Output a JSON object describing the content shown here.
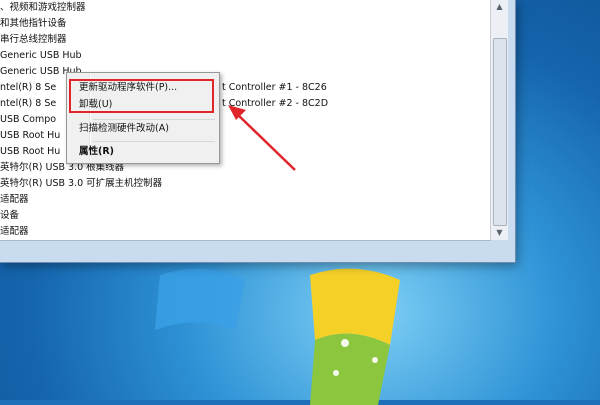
{
  "tree": {
    "rows": [
      "、视频和游戏控制器",
      "和其他指针设备",
      "串行总线控制器",
      "Generic USB Hub",
      "Generic USB Hub",
      "ntel(R) 8 Se",
      "ntel(R) 8 Se",
      "USB Compo",
      "USB Root Hu",
      "USB Root Hu",
      "英特尔(R) USB 3.0 根集线器",
      "英特尔(R) USB 3.0 可扩展主机控制器",
      "适配器",
      "设备",
      "适配器"
    ],
    "row_tail_1": "t Controller #1 - 8C26",
    "row_tail_2": "t Controller #2 - 8C2D"
  },
  "context_menu": {
    "update_driver": "更新驱动程序软件(P)...",
    "uninstall": "卸载(U)",
    "scan_hardware": "扫描检测硬件改动(A)",
    "properties": "属性(R)"
  },
  "colors": {
    "highlight": "#e0252b",
    "arrow": "#e0252b"
  }
}
